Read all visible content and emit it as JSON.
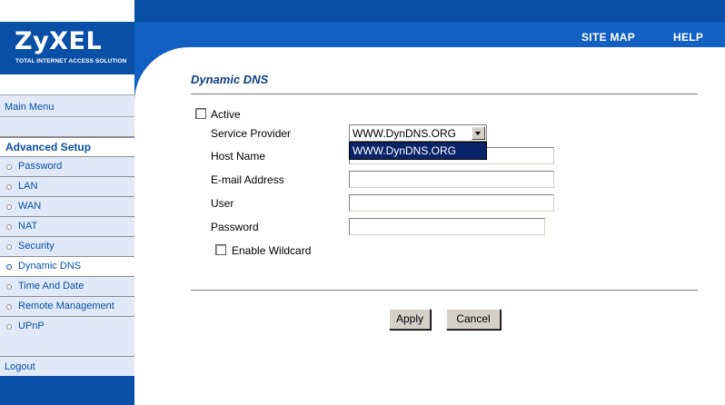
{
  "header": {
    "links": [
      "SITE MAP",
      "HELP"
    ]
  },
  "brand": {
    "logo_text": "ZyXEL",
    "tagline": "Total Internet Access Solution"
  },
  "sidebar": {
    "main_menu": "Main Menu",
    "section_title": "Advanced Setup",
    "items": [
      "Password",
      "LAN",
      "WAN",
      "NAT",
      "Security",
      "Dynamic DNS",
      "Time And Date",
      "Remote Management",
      "UPnP"
    ],
    "active_item": "Dynamic DNS",
    "logout": "Logout"
  },
  "page": {
    "title": "Dynamic DNS"
  },
  "form": {
    "active_label": "Active",
    "active_checked": false,
    "service_provider_label": "Service Provider",
    "service_provider_value": "WWW.DynDNS.ORG",
    "service_provider_options": [
      "WWW.DynDNS.ORG"
    ],
    "host_name_label": "Host Name",
    "host_name_value": "",
    "email_label": "E-mail Address",
    "email_value": "",
    "user_label": "User",
    "user_value": "",
    "password_label": "Password",
    "password_value": "",
    "wildcard_label": "Enable Wildcard",
    "wildcard_checked": false
  },
  "buttons": {
    "apply": "Apply",
    "cancel": "Cancel"
  },
  "colors": {
    "brand_blue": "#0a4fa6",
    "sidebar_bg": "#dfe9f7",
    "title_blue": "#0a3f84"
  }
}
